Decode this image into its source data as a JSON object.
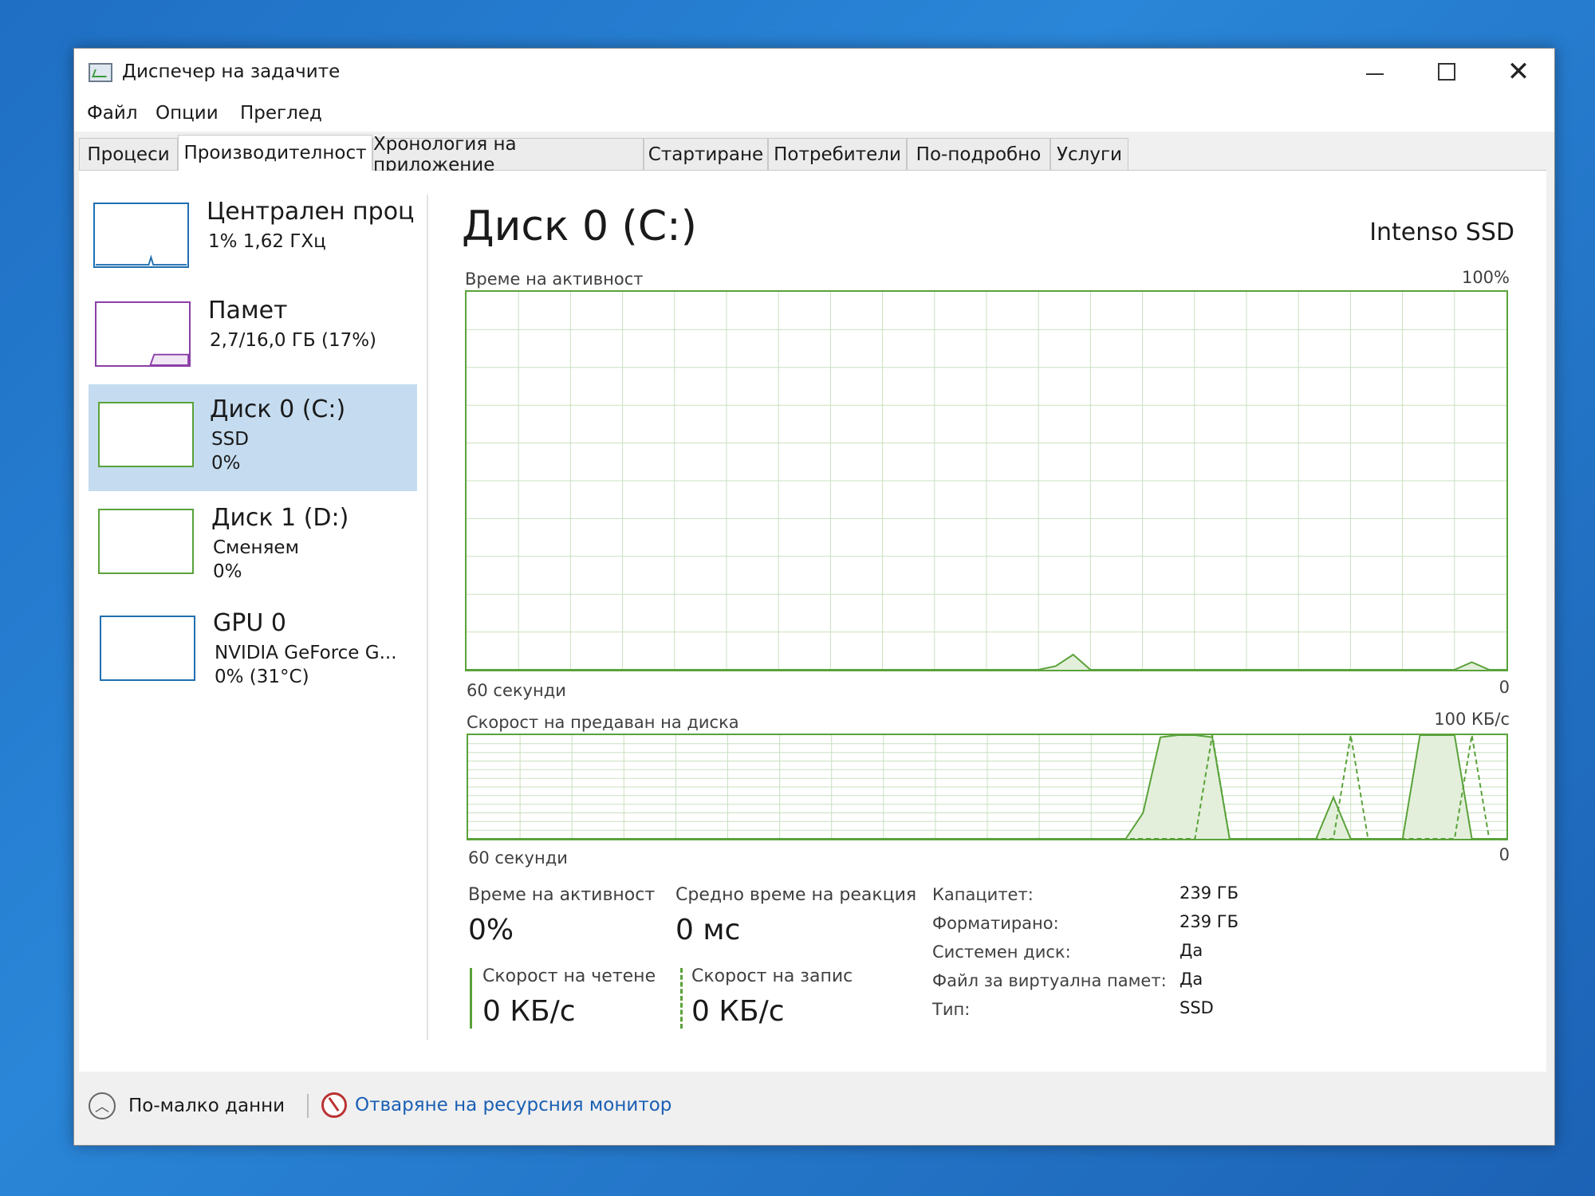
{
  "window": {
    "title": "Диспечер на задачите"
  },
  "menu": [
    "Файл",
    "Опции",
    "Преглед"
  ],
  "tabs": [
    "Процеси",
    "Производителност",
    "Хронология на приложение",
    "Стартиране",
    "Потребители",
    "По-подробно",
    "Услуги"
  ],
  "active_tab": "Производителност",
  "sidebar": {
    "items": [
      {
        "title": "Централен процесор",
        "line1": "1% 1,62 ГХц",
        "line2": ""
      },
      {
        "title": "Памет",
        "line1": "2,7/16,0 ГБ (17%)",
        "line2": ""
      },
      {
        "title": "Диск 0 (C:)",
        "line1": "SSD",
        "line2": "0%"
      },
      {
        "title": "Диск 1 (D:)",
        "line1": "Сменяем",
        "line2": "0%"
      },
      {
        "title": "GPU 0",
        "line1": "NVIDIA GeForce G...",
        "line2": "0% (31°C)"
      }
    ],
    "selected_index": 2
  },
  "main": {
    "title": "Диск 0 (C:)",
    "model": "Intenso SSD",
    "activity_chart": {
      "label": "Време на активност",
      "max_label": "100%",
      "x_left": "60 секунди",
      "x_right": "0"
    },
    "transfer_chart": {
      "label": "Скорост на предаван на диска",
      "max_label": "100 КБ/с",
      "x_left": "60 секунди",
      "x_right": "0"
    },
    "stats": {
      "active_time_label": "Време на активност",
      "active_time_value": "0%",
      "response_label": "Средно време на реакция",
      "response_value": "0 мс",
      "read_label": "Скорост на четене",
      "read_value": "0 КБ/с",
      "write_label": "Скорост на запис",
      "write_value": "0 КБ/с"
    },
    "properties": [
      {
        "label": "Капацитет:",
        "value": "239 ГБ"
      },
      {
        "label": "Форматирано:",
        "value": "239 ГБ"
      },
      {
        "label": "Системен диск:",
        "value": "Да"
      },
      {
        "label": "Файл за виртуална памет:",
        "value": "Да"
      },
      {
        "label": "Тип:",
        "value": "SSD"
      }
    ]
  },
  "footer": {
    "fewer_details": "По-малко данни",
    "resource_monitor": "Отваряне на ресурсния монитор"
  },
  "colors": {
    "disk_accent": "#5aa23a",
    "selected_bg": "#c5dcf0",
    "link": "#1a5fb4",
    "desktop": "#1f6fc4"
  },
  "chart_data": [
    {
      "type": "area",
      "title": "Време на активност",
      "xlabel": "60 секунди",
      "x": [
        60,
        55,
        50,
        45,
        40,
        35,
        30,
        27,
        26,
        25,
        24,
        20,
        15,
        10,
        5,
        3,
        2,
        1,
        0
      ],
      "series": [
        {
          "values": [
            0,
            0,
            0,
            0,
            0,
            0,
            0,
            0,
            1,
            4,
            0,
            0,
            0,
            0,
            0,
            0,
            2,
            0,
            0
          ]
        }
      ],
      "ylim": [
        0,
        100
      ]
    },
    {
      "type": "area",
      "title": "Скорост на предаван на диска",
      "xlabel": "60 секунди",
      "x": [
        60,
        55,
        50,
        45,
        40,
        35,
        30,
        22,
        21,
        20,
        19,
        18,
        17,
        16,
        15,
        14,
        13,
        12,
        11,
        10,
        9,
        8,
        7,
        6,
        5,
        4,
        3,
        2,
        1,
        0
      ],
      "series": [
        {
          "values": [
            0,
            0,
            0,
            0,
            0,
            0,
            0,
            0,
            25,
            98,
            100,
            100,
            98,
            0,
            0,
            0,
            0,
            0,
            0,
            40,
            0,
            0,
            0,
            0,
            100,
            100,
            100,
            0,
            0,
            0
          ]
        },
        {
          "values": [
            0,
            0,
            0,
            0,
            0,
            0,
            0,
            0,
            0,
            0,
            0,
            0,
            100,
            0,
            0,
            0,
            0,
            0,
            0,
            0,
            100,
            0,
            0,
            0,
            0,
            0,
            0,
            100,
            0,
            0
          ]
        }
      ],
      "ylim": [
        0,
        100
      ]
    }
  ]
}
